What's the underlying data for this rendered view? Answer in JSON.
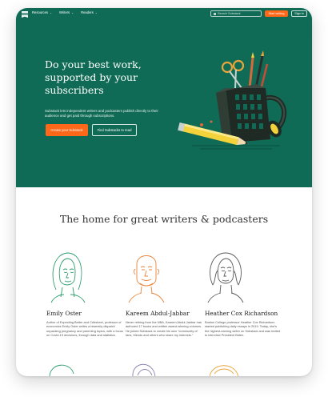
{
  "nav": {
    "menu": [
      {
        "label": "Resources"
      },
      {
        "label": "Writers"
      },
      {
        "label": "Readers"
      }
    ],
    "search_placeholder": "Search Substack",
    "start_writing": "Start writing",
    "sign_in": "Sign in"
  },
  "hero": {
    "title": "Do your best work, supported by your subscribers",
    "description": "Substack lets independent writers and podcasters publish directly to their audience and get paid through subscriptions.",
    "create_button": "Create your Substack",
    "find_button": "Find Substacks to read"
  },
  "writers_section": {
    "title": "The home for great writers & podcasters",
    "writers": [
      {
        "name": "Emily Oster",
        "bio": "Author of Expecting Better and Cribsheet, professor of economics Emily Oster writes a biweekly dispatch unpacking pregnancy and parenting topics, with a focus on Covid-19 decisions, through data and statistics."
      },
      {
        "name": "Kareem Abdul-Jabbar",
        "bio": "Never retiring from the NBA, Kareem Abdul-Jabbar has authored 17 books and written award-winning columns. He joined Substack to create his own \"community of fans, friends and others who share my interests.\""
      },
      {
        "name": "Heather Cox Richardson",
        "bio": "Boston College professor Heather Cox Richardson started publishing daily essays in 2019. Today, she's the highest-earning writer on Substack and was invited to interview President Biden."
      }
    ]
  },
  "colors": {
    "brand_green": "#0f6b55",
    "accent_orange": "#ff6719",
    "writer_line_colors": [
      "#2e9e6e",
      "#e8833a",
      "#5a5a5a"
    ]
  }
}
